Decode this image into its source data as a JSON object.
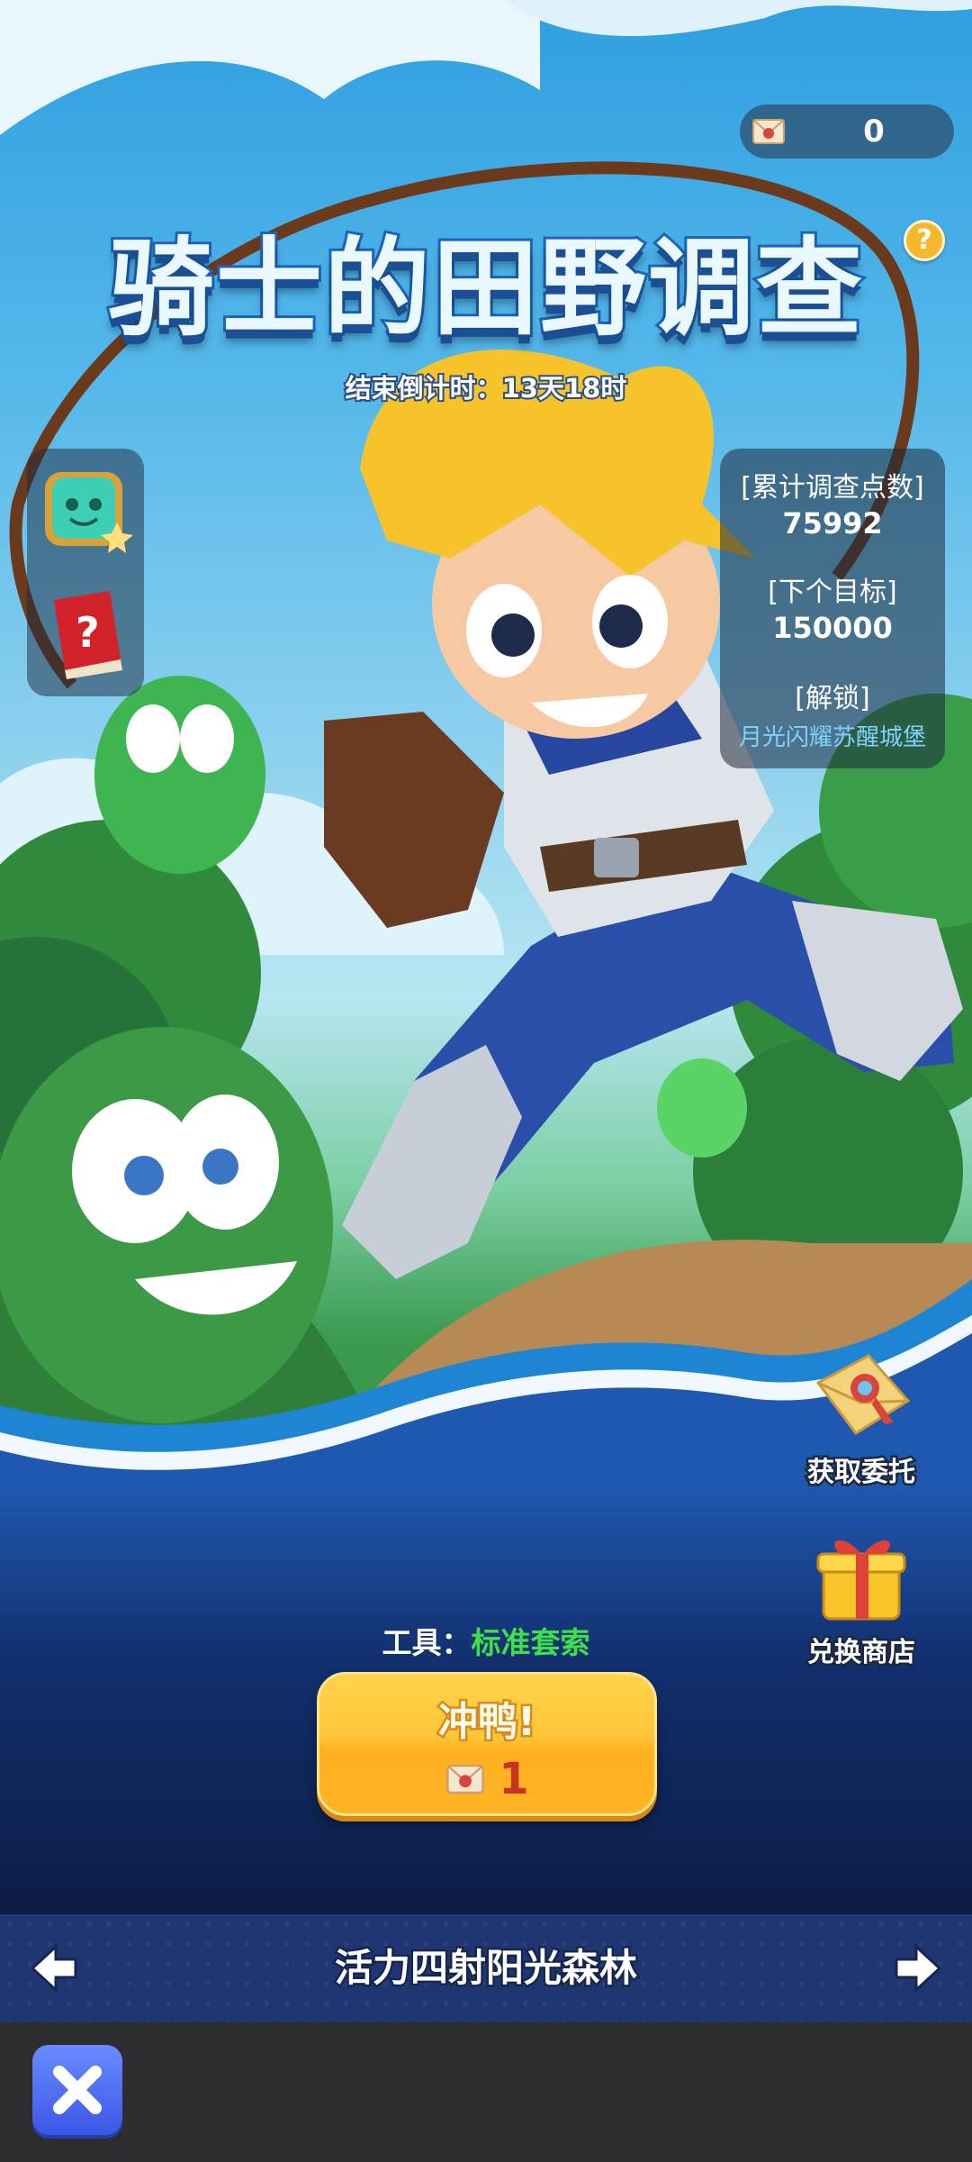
{
  "header": {
    "title": "骑士的田野调查",
    "countdown": "结束倒计时：13天18时",
    "help_label": "?"
  },
  "currency": {
    "icon": "ticket-icon",
    "value": "0"
  },
  "side_buttons": [
    {
      "name": "slime-reward-icon"
    },
    {
      "name": "question-book-icon"
    }
  ],
  "stats": {
    "total_label": "[累计调查点数]",
    "total_value": "75992",
    "next_label": "[下个目标]",
    "next_value": "150000",
    "unlock_label": "[解锁]",
    "unlock_value": "月光闪耀苏醒城堡"
  },
  "actions": {
    "get_commission": "获取委托",
    "exchange_shop": "兑换商店"
  },
  "tool": {
    "label": "工具：",
    "value": "标准套索"
  },
  "go_button": {
    "label": "冲鸭!",
    "cost": "1",
    "cost_icon": "ticket-icon"
  },
  "nav": {
    "title": "活力四射阳光森林",
    "prev": "left-arrow-icon",
    "next": "right-arrow-icon"
  },
  "system": {
    "close": "close-icon"
  },
  "colors": {
    "tool_value": "#3fe04a",
    "unlock_value": "#7fd2ff",
    "button": "#ffc53a",
    "nav_bg": "#1f3672"
  }
}
